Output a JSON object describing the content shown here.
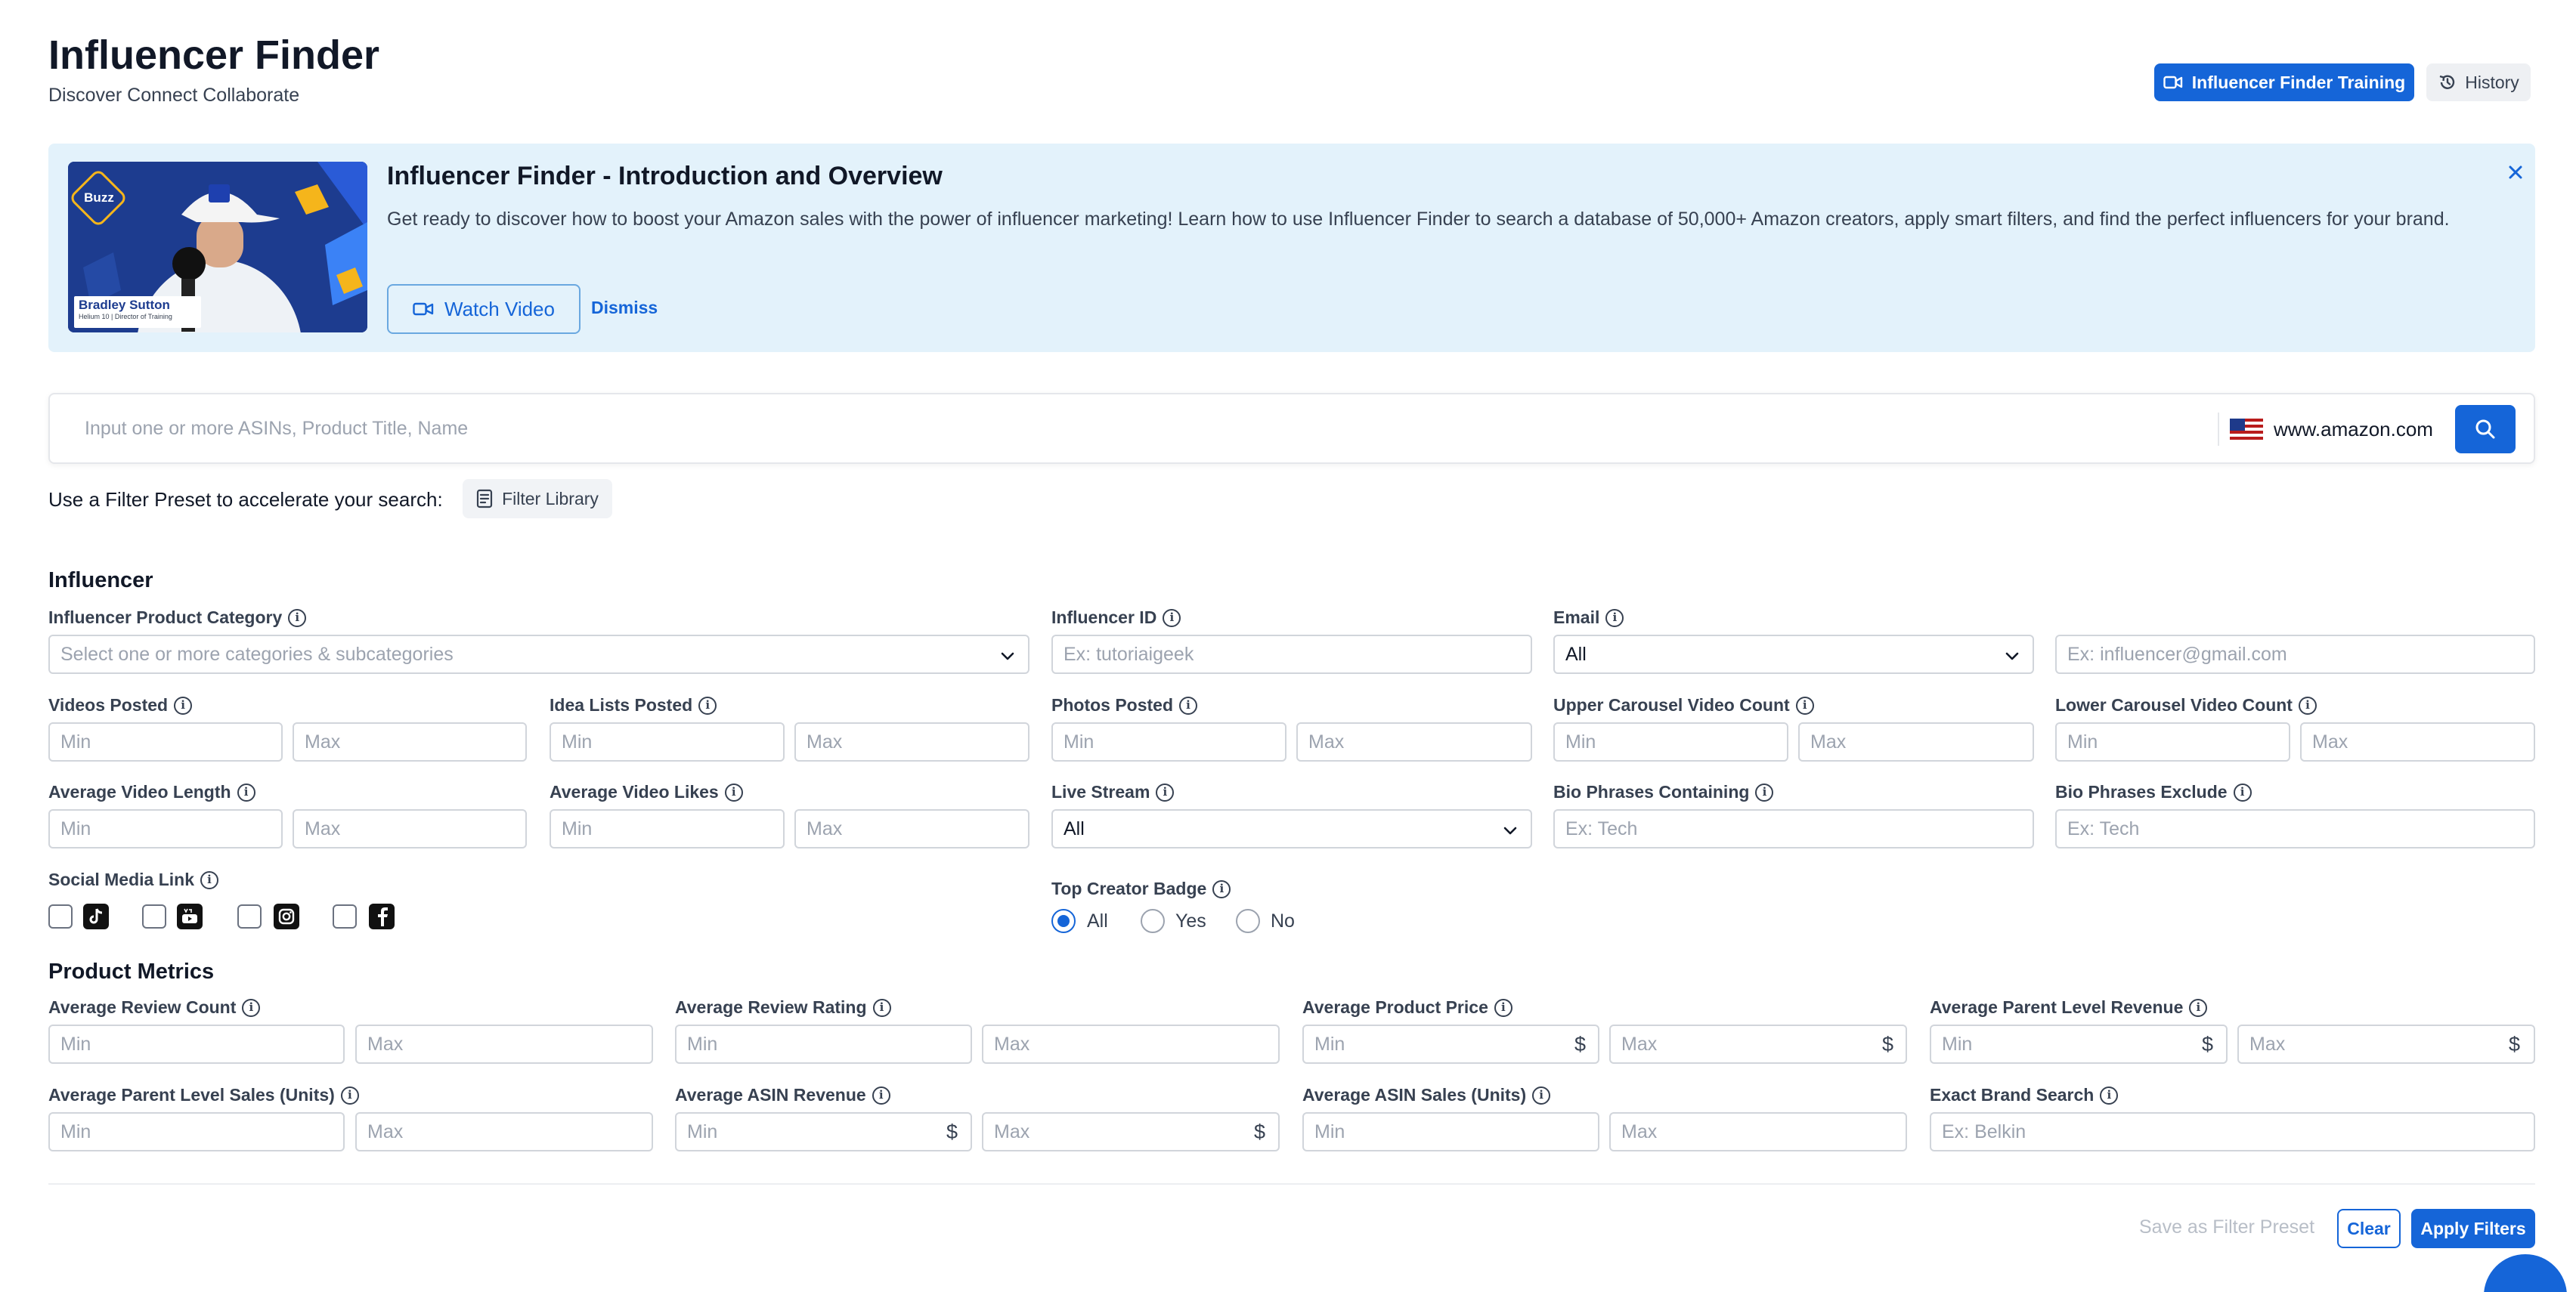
{
  "header": {
    "title": "Influencer Finder",
    "subtitle": "Discover Connect Collaborate",
    "training_button": "Influencer Finder Training",
    "history_button": "History"
  },
  "banner": {
    "title": "Influencer Finder - Introduction and Overview",
    "description": "Get ready to discover how to boost your Amazon sales with the power of influencer marketing! Learn how to use Influencer Finder to search a database of 50,000+ Amazon creators, apply smart filters, and find the perfect influencers for your brand.",
    "watch_button": "Watch Video",
    "dismiss_button": "Dismiss",
    "thumbnail": {
      "badge": "Buzz",
      "presenter_name": "Bradley Sutton",
      "presenter_role": "Helium 10 | Director of Training"
    }
  },
  "search": {
    "placeholder": "Input one or more ASINs, Product Title, Name",
    "marketplace": "www.amazon.com"
  },
  "preset": {
    "text": "Use a Filter Preset to accelerate your search:",
    "library_button": "Filter Library"
  },
  "influencer": {
    "section_title": "Influencer",
    "product_category": {
      "label": "Influencer Product Category",
      "placeholder": "Select one or more categories & subcategories"
    },
    "influencer_id": {
      "label": "Influencer ID",
      "placeholder": "Ex: tutoriaigeek"
    },
    "email": {
      "label": "Email",
      "selected": "All",
      "placeholder": "Ex: influencer@gmail.com"
    },
    "videos_posted": {
      "label": "Videos Posted"
    },
    "idea_lists_posted": {
      "label": "Idea Lists Posted"
    },
    "photos_posted": {
      "label": "Photos Posted"
    },
    "upper_carousel": {
      "label": "Upper Carousel Video Count"
    },
    "lower_carousel": {
      "label": "Lower Carousel Video Count"
    },
    "avg_video_length": {
      "label": "Average Video Length"
    },
    "avg_video_likes": {
      "label": "Average Video Likes"
    },
    "live_stream": {
      "label": "Live Stream",
      "selected": "All"
    },
    "bio_containing": {
      "label": "Bio Phrases Containing",
      "placeholder": "Ex: Tech"
    },
    "bio_exclude": {
      "label": "Bio Phrases Exclude",
      "placeholder": "Ex: Tech"
    },
    "social_media": {
      "label": "Social Media Link",
      "icons": [
        "tiktok-icon",
        "youtube-icon",
        "instagram-icon",
        "facebook-icon"
      ]
    },
    "top_creator": {
      "label": "Top Creator Badge",
      "options": [
        "All",
        "Yes",
        "No"
      ],
      "selected": "All"
    }
  },
  "product_metrics": {
    "section_title": "Product Metrics",
    "avg_review_count": {
      "label": "Average Review Count"
    },
    "avg_review_rating": {
      "label": "Average Review Rating"
    },
    "avg_product_price": {
      "label": "Average Product Price"
    },
    "avg_parent_revenue": {
      "label": "Average Parent Level Revenue"
    },
    "avg_parent_sales": {
      "label": "Average Parent Level Sales (Units)"
    },
    "avg_asin_revenue": {
      "label": "Average ASIN Revenue"
    },
    "avg_asin_sales": {
      "label": "Average ASIN Sales (Units)"
    },
    "exact_brand": {
      "label": "Exact Brand Search",
      "placeholder": "Ex: Belkin"
    }
  },
  "common": {
    "min": "Min",
    "max": "Max",
    "currency": "$",
    "info": "i"
  },
  "footer": {
    "save_preset": "Save as Filter Preset",
    "clear": "Clear",
    "apply": "Apply Filters"
  },
  "colors": {
    "primary": "#1565d8",
    "banner_bg": "#e3f2fb"
  }
}
